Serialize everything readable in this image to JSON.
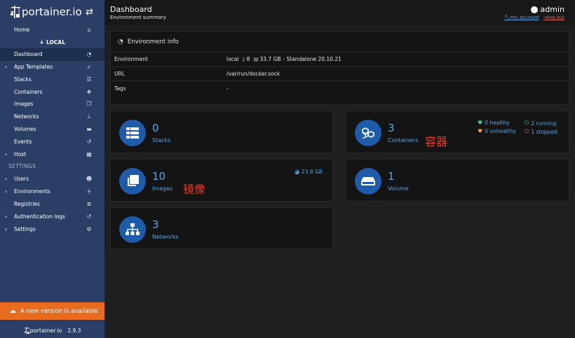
{
  "app": {
    "logo_text": "portainer.io",
    "version": "2.9.3",
    "update_banner": "A new version is available"
  },
  "sidebar": {
    "home": "Home",
    "env_label": "LOCAL",
    "items": [
      {
        "label": "Dashboard",
        "icon": "dashboard-icon",
        "active": true,
        "chevron": false
      },
      {
        "label": "App Templates",
        "icon": "rocket-icon",
        "active": false,
        "chevron": true
      },
      {
        "label": "Stacks",
        "icon": "list-icon",
        "active": false,
        "chevron": false
      },
      {
        "label": "Containers",
        "icon": "cubes-icon",
        "active": false,
        "chevron": false
      },
      {
        "label": "Images",
        "icon": "clone-icon",
        "active": false,
        "chevron": false
      },
      {
        "label": "Networks",
        "icon": "sitemap-icon",
        "active": false,
        "chevron": false
      },
      {
        "label": "Volumes",
        "icon": "hdd-icon",
        "active": false,
        "chevron": false
      },
      {
        "label": "Events",
        "icon": "history-icon",
        "active": false,
        "chevron": false
      },
      {
        "label": "Host",
        "icon": "th-icon",
        "active": false,
        "chevron": true
      }
    ],
    "settings_header": "SETTINGS",
    "settings_items": [
      {
        "label": "Users",
        "icon": "users-icon",
        "chevron": true
      },
      {
        "label": "Environments",
        "icon": "plug-icon",
        "chevron": true
      },
      {
        "label": "Registries",
        "icon": "database-icon",
        "chevron": false
      },
      {
        "label": "Authentication logs",
        "icon": "history-icon",
        "chevron": true
      },
      {
        "label": "Settings",
        "icon": "cogs-icon",
        "chevron": true
      }
    ]
  },
  "header": {
    "title": "Dashboard",
    "subtitle": "Environment summary",
    "user": "admin",
    "my_account": "my account",
    "log_out": "log out"
  },
  "env_info": {
    "title": "Environment info",
    "rows": [
      {
        "key": "Environment",
        "value_name": "local",
        "cpu": "8",
        "memory": "33.7 GB",
        "suffix": "- Standalone 20.10.21"
      },
      {
        "key": "URL",
        "value": "/var/run/docker.sock"
      },
      {
        "key": "Tags",
        "value": "-"
      }
    ]
  },
  "cards": {
    "stacks": {
      "count": "0",
      "label": "Stacks"
    },
    "containers": {
      "count": "3",
      "label": "Containers",
      "annotation": "容器",
      "healthy": "0 healthy",
      "running": "2 running",
      "unhealthy": "0 unhealthy",
      "stopped": "1 stopped"
    },
    "images": {
      "count": "10",
      "label": "Images",
      "annotation": "镜像",
      "size": "23.8 GB"
    },
    "volumes": {
      "count": "1",
      "label": "Volume"
    },
    "networks": {
      "count": "3",
      "label": "Networks"
    }
  },
  "colors": {
    "sidebar_bg": "#2b3f66",
    "accent_blue": "#58a6e6",
    "circle_blue": "#1e5ba8",
    "update_orange": "#e86c1e",
    "annotation_red": "#e83a2a",
    "healthy_green": "#3dd6a3",
    "unhealthy_orange": "#f0a030",
    "stopped_red": "#e8603a"
  }
}
